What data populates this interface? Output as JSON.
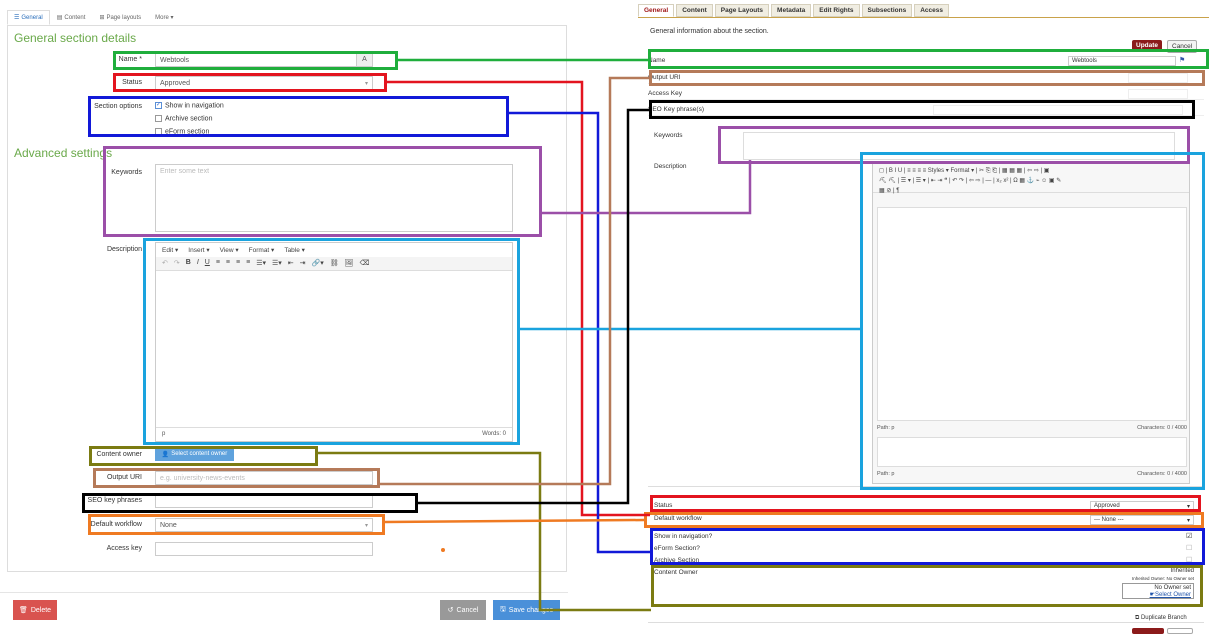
{
  "left": {
    "tabs": [
      {
        "icon": "sliders-icon",
        "label": "General"
      },
      {
        "icon": "doc-icon",
        "label": "Content"
      },
      {
        "icon": "sitemap-icon",
        "label": "Page layouts"
      },
      {
        "icon": "",
        "label": "More ▾"
      }
    ],
    "general_heading": "General section details",
    "name_label": "Name *",
    "name_value": "Webtools",
    "name_badge": "A",
    "status_label": "Status",
    "status_value": "Approved",
    "section_options_label": "Section options",
    "options": [
      {
        "label": "Show in navigation",
        "checked": true
      },
      {
        "label": "Archive section",
        "checked": false
      },
      {
        "label": "eForm section",
        "checked": false
      }
    ],
    "advanced_heading": "Advanced settings",
    "keywords_label": "Keywords",
    "keywords_placeholder": "Enter some text",
    "description_label": "Description",
    "editor_menu": [
      "Edit ▾",
      "Insert ▾",
      "View ▾",
      "Format ▾",
      "Table ▾"
    ],
    "editor_toolbar": [
      "↶",
      "↷",
      "B",
      "I",
      "U",
      "≡",
      "≡",
      "≡",
      "≡",
      "☰▾",
      "☰▾",
      "⇤",
      "⇥",
      "🔗▾",
      "⛓",
      "🖼",
      "⌫"
    ],
    "editor_path": "p",
    "editor_words": "Words: 0",
    "content_owner_label": "Content owner",
    "content_owner_button": "Select content owner",
    "output_uri_label": "Output URI",
    "output_uri_placeholder": "e.g. university-news-events",
    "seo_label": "SEO key phrases",
    "workflow_label": "Default workflow",
    "workflow_value": "None",
    "access_key_label": "Access key",
    "delete_label": "Delete",
    "cancel_label": "Cancel",
    "save_label": "Save changes"
  },
  "right": {
    "tabs": [
      "General",
      "Content",
      "Page Layouts",
      "Metadata",
      "Edit Rights",
      "Subsections",
      "Access"
    ],
    "intro": "General information about the section.",
    "update_label": "Update",
    "cancel_label": "Cancel",
    "name_label": "Name",
    "name_value": "Webtools",
    "output_uri_label": "Output URI",
    "access_key_label": "Access Key",
    "seo_label": "SEO Key phrase(s)",
    "keywords_label": "Keywords",
    "description_label": "Description",
    "editor_toolbar_line1": "◻ | B I U | ≡ ≡ ≡ ≡  Styles ▾  Format ▾ | ✂ ⎘ ⎗ | ▦ ▦ ▦ | ⇦ ⇨ | ▣",
    "editor_toolbar_line2": "⛏ ⛏ | ☰ ▾ | ☰ ▾ | ⇤ ⇥ ❝ | ↶ ↷ | ⇦ ⇨ | — | x₂ x² | Ω ▦ ⚓ ⌁ ☺ ▣ ✎",
    "editor_toolbar_line3": "▦ ⊘ | ¶",
    "editor_path1": "Path: p",
    "editor_chars1": "Characters: 0 / 4000",
    "editor_path2": "Path: p",
    "editor_chars2": "Characters: 0 / 4000",
    "status_label": "Status",
    "status_value": "Approved",
    "workflow_label": "Default workflow",
    "workflow_value": "--- None ---",
    "show_nav_label": "Show in navigation?",
    "eform_label": "eForm Section?",
    "archive_label": "Archive Section",
    "content_owner_label": "Content Owner",
    "inherited_label": "Inherited",
    "inherited_owner": "Inherited Owner: No Owner set",
    "no_owner": "No Owner set",
    "select_owner": "Select Owner",
    "duplicate_branch": "Duplicate Branch"
  },
  "colors": {
    "green": "#1fae3c",
    "red": "#e3141f",
    "blue": "#1219d8",
    "purple": "#9b4fa8",
    "cyan": "#1aa3de",
    "brown": "#b57a59",
    "black": "#000000",
    "olive": "#7b7b12",
    "orange": "#ef7a22"
  }
}
